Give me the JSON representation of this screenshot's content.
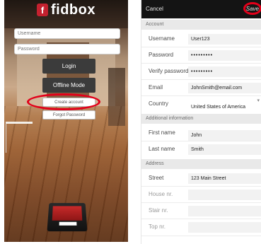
{
  "left": {
    "logo_mark": "f",
    "logo_text": "fidbox",
    "username_placeholder": "Username",
    "password_placeholder": "Password",
    "login_label": "Login",
    "offline_label": "Offline Mode",
    "create_account_label": "Create account",
    "forgot_password_label": "Forgot Password"
  },
  "right": {
    "cancel_label": "Cancel",
    "save_label": "Save",
    "sections": {
      "account": "Account",
      "additional": "Additional information",
      "address": "Address"
    },
    "fields": {
      "username": {
        "label": "Username",
        "value": "User123"
      },
      "password": {
        "label": "Password",
        "value": "•••••••••"
      },
      "verify_password": {
        "label": "Verify password",
        "value": "•••••••••"
      },
      "email": {
        "label": "Email",
        "value": "JohnSmith@email.com"
      },
      "country": {
        "label": "Country",
        "value": "United States of America"
      },
      "first_name": {
        "label": "First name",
        "value": "John"
      },
      "last_name": {
        "label": "Last name",
        "value": "Smith"
      },
      "street": {
        "label": "Street",
        "value": "123 Main Street"
      },
      "house_nr": {
        "label": "House nr.",
        "value": ""
      },
      "stair_nr": {
        "label": "Stair nr.",
        "value": ""
      },
      "top_nr": {
        "label": "Top nr.",
        "value": ""
      }
    }
  },
  "colors": {
    "brand": "#c4212f",
    "highlight": "#e2001a",
    "top_bar": "#141414"
  }
}
